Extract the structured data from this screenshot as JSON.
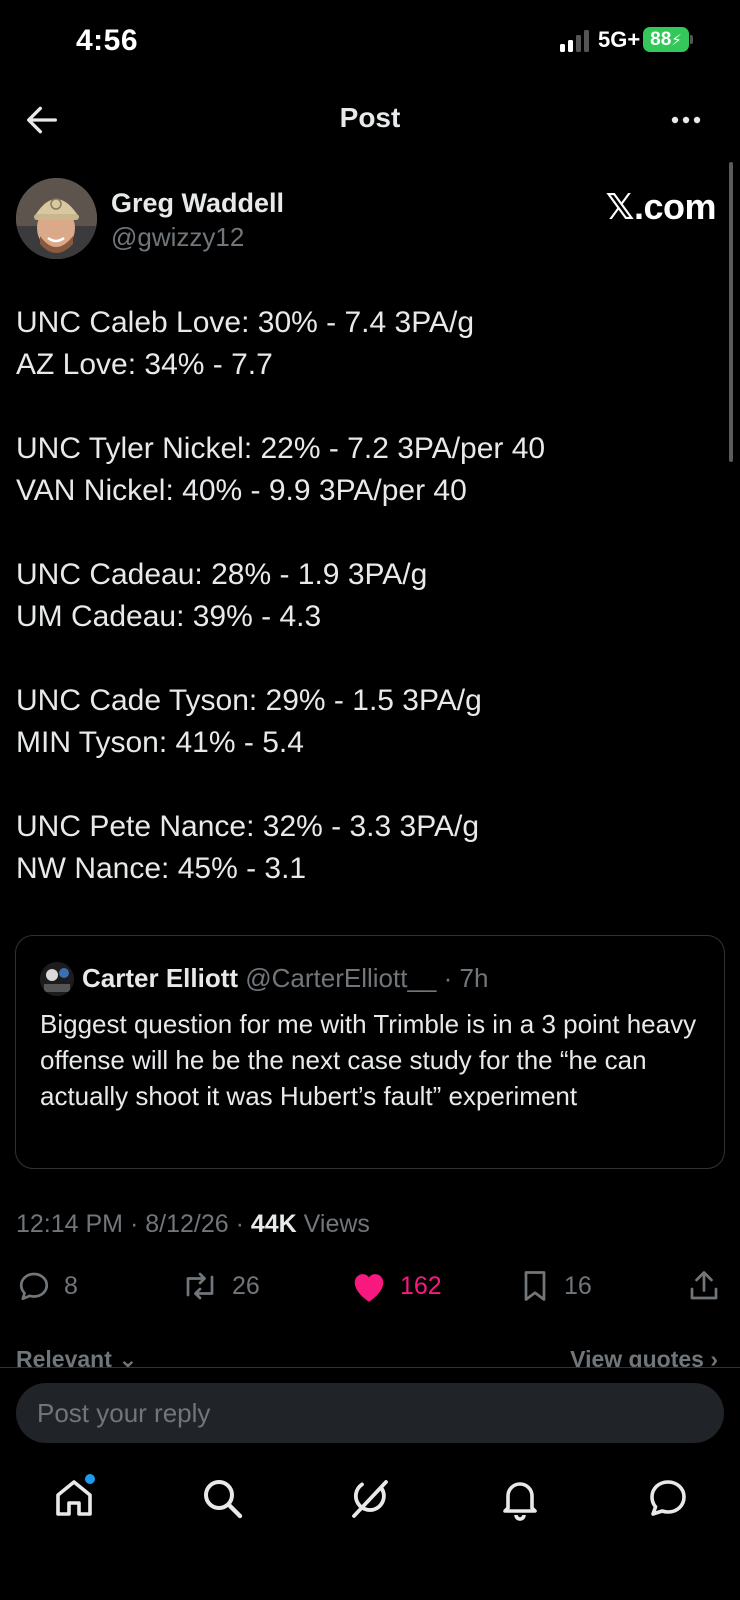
{
  "status_bar": {
    "time": "4:56",
    "network": "5G+",
    "battery": "88"
  },
  "nav": {
    "title": "Post",
    "back_icon": "arrow-left-icon",
    "more_icon": "more-horizontal-icon"
  },
  "post": {
    "author_name": "Greg Waddell",
    "author_handle": "@gwizzy12",
    "brand": "𝕏.com",
    "lines": [
      "UNC Caleb Love: 30% - 7.4 3PA/g",
      "AZ Love: 34% - 7.7",
      "",
      "UNC Tyler Nickel: 22% - 7.2 3PA/per 40",
      "VAN Nickel: 40% - 9.9 3PA/per 40",
      "",
      "UNC Cadeau: 28% - 1.9 3PA/g",
      "UM Cadeau: 39% - 4.3",
      "",
      "UNC Cade Tyson: 29% - 1.5 3PA/g",
      "MIN Tyson: 41% - 5.4",
      "",
      "UNC Pete Nance: 32% - 3.3 3PA/g",
      "NW Nance: 45% - 3.1"
    ],
    "quote": {
      "name": "Carter Elliott",
      "handle_time": " @CarterElliott__ · 7h",
      "text": "Biggest question for me with Trimble is in a 3 point heavy offense will he be the next case study for the “he can actually shoot it was Hubert’s fault” experiment"
    },
    "meta": {
      "time_date": "12:14 PM · 8/12/26 · ",
      "views_count": "44K",
      "views_label": " Views"
    },
    "actions": {
      "replies": "8",
      "reposts": "26",
      "likes": "162",
      "bookmarks": "16"
    },
    "like_color": "#f91880"
  },
  "sort": {
    "left": "Relevant ⌄",
    "right": "View quotes ›"
  },
  "reply": {
    "placeholder": "Post your reply"
  },
  "tabbar": {
    "items": [
      "home-icon",
      "search-icon",
      "grok-icon",
      "notifications-bell-icon",
      "messages-icon"
    ]
  }
}
